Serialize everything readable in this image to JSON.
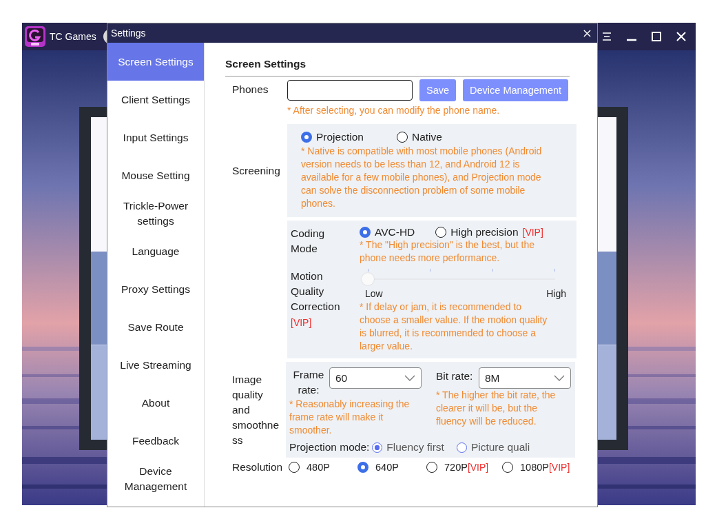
{
  "app": {
    "title": "TC Games"
  },
  "dialog": {
    "title": "Settings"
  },
  "sidebar": {
    "items": [
      {
        "label": "Screen Settings",
        "selected": true
      },
      {
        "label": "Client Settings",
        "selected": false
      },
      {
        "label": "Input Settings",
        "selected": false
      },
      {
        "label": "Mouse Setting",
        "selected": false
      },
      {
        "label": "Trickle-Power settings",
        "selected": false
      },
      {
        "label": "Language",
        "selected": false
      },
      {
        "label": "Proxy Settings",
        "selected": false
      },
      {
        "label": "Save Route",
        "selected": false
      },
      {
        "label": "Live Streaming",
        "selected": false
      },
      {
        "label": "About",
        "selected": false
      },
      {
        "label": "Feedback",
        "selected": false
      },
      {
        "label": "Device Management",
        "selected": false
      }
    ]
  },
  "content": {
    "heading": "Screen Settings",
    "phones": {
      "label": "Phones",
      "save": "Save",
      "manage": "Device Management",
      "hint": "* After selecting, you can modify the phone name."
    },
    "screening": {
      "label": "Screening",
      "options": [
        {
          "label": "Projection",
          "selected": true
        },
        {
          "label": "Native",
          "selected": false
        }
      ],
      "hint": "* Native is compatible with most mobile phones (Android version needs to be less than 12, and Android 12 is available for a few mobile phones), and Projection mode can solve the disconnection problem of some mobile phones."
    },
    "coding": {
      "label": "Coding Mode",
      "options": [
        {
          "label": "AVC-HD",
          "selected": true
        },
        {
          "label": "High precision",
          "badge": "[VIP]",
          "selected": false
        }
      ],
      "hint": "* The \"High precision\" is the best, but the phone needs more performance."
    },
    "motion": {
      "label": "Motion Quality Correction",
      "badge": "[VIP]",
      "level": 0,
      "low": "Low",
      "high": "High",
      "hint": "* If delay or jam, it is recommended to choose a smaller value. If the motion quality is blurred, it is recommended to choose a larger value."
    },
    "image": {
      "label": "Image quality and smoothne ss",
      "frame_rate": {
        "label": "Frame rate:",
        "value": "60",
        "hint": "* Reasonably increasing the frame rate will make it smoother."
      },
      "bit_rate": {
        "label": "Bit rate:",
        "value": "8M",
        "hint": "* The higher the bit rate, the clearer it will be, but the fluency will be reduced."
      },
      "projection_mode": {
        "label": "Projection mode:",
        "options": [
          {
            "label": "Fluency first",
            "selected": true
          },
          {
            "label": "Picture quali",
            "selected": false
          }
        ]
      }
    },
    "resolution": {
      "label": "Resolution",
      "options": [
        {
          "label": "480P",
          "selected": false
        },
        {
          "label": "640P",
          "selected": true
        },
        {
          "label": "720P",
          "badge": "[VIP]",
          "selected": false
        },
        {
          "label": "1080P",
          "badge": "[VIP]",
          "selected": false
        }
      ]
    }
  }
}
